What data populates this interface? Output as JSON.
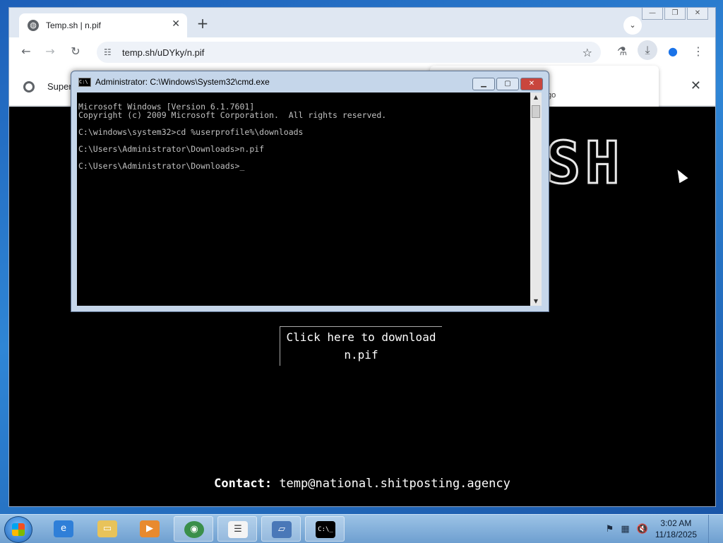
{
  "browser": {
    "tab": {
      "title": "Temp.sh | n.pif",
      "favicon": "globe-icon"
    },
    "new_tab_symbol": "+",
    "window_controls": [
      "—",
      "❐",
      "✕"
    ],
    "address": "temp.sh/uDYky/n.pif",
    "infobar": {
      "text": "Super"
    },
    "popup_text": "go",
    "page": {
      "logo_fragment": "SH",
      "download_line1": "Click here to download",
      "download_line2": "n.pif",
      "contact_label": "Contact:",
      "contact_email": "temp@national.shitposting.agency"
    }
  },
  "cmd": {
    "title": "Administrator: C:\\Windows\\System32\\cmd.exe",
    "icon_label": "C:\\",
    "lines": [
      "Microsoft Windows [Version 6.1.7601]",
      "Copyright (c) 2009 Microsoft Corporation.  All rights reserved.",
      "",
      "C:\\windows\\system32>cd %userprofile%\\downloads",
      "",
      "C:\\Users\\Administrator\\Downloads>n.pif",
      "",
      "C:\\Users\\Administrator\\Downloads>_"
    ]
  },
  "taskbar": {
    "items": [
      "ie-icon",
      "explorer-icon",
      "media-player-icon",
      "chrome-icon",
      "task-list-icon",
      "window-icon",
      "cmd-icon"
    ],
    "clock_time": "3:02 AM",
    "clock_date": "11/18/2025"
  },
  "colors": {
    "page_bg": "#000000",
    "taskbar": "#6e9fd0",
    "cmd_close": "#c9463d"
  }
}
